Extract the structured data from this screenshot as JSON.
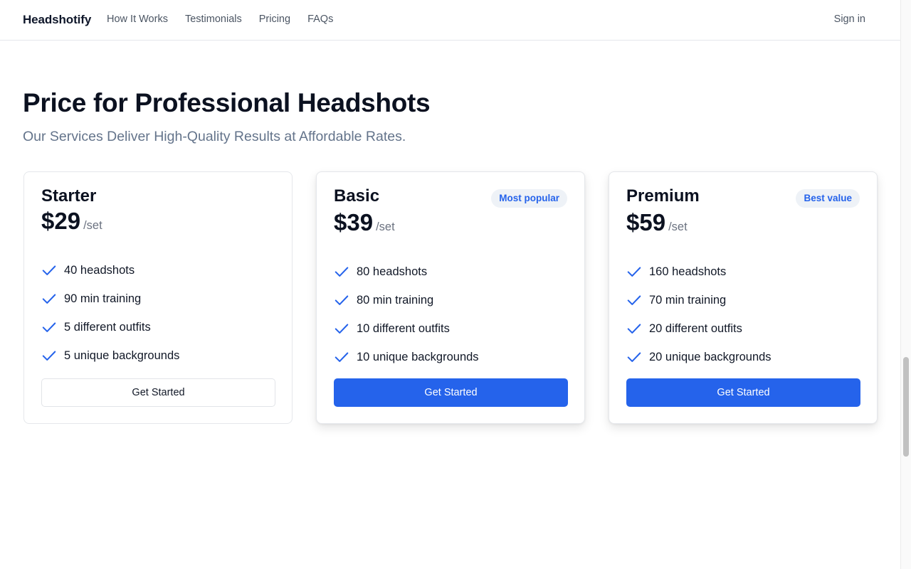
{
  "nav": {
    "brand": "Headshotify",
    "links": [
      "How It Works",
      "Testimonials",
      "Pricing",
      "FAQs"
    ],
    "signin": "Sign in"
  },
  "hero": {
    "title": "Price for Professional Headshots",
    "subtitle": "Our Services Deliver High-Quality Results at Affordable Rates."
  },
  "colors": {
    "accent": "#2563eb",
    "check": "#2563eb",
    "badge_bg": "#eef2f7"
  },
  "plans": [
    {
      "name": "Starter",
      "badge": "",
      "price": "$29",
      "unit": "/set",
      "features": [
        "40 headshots",
        "90 min training",
        "5 different outfits",
        "5 unique backgrounds"
      ],
      "cta": "Get Started",
      "cta_style": "outline"
    },
    {
      "name": "Basic",
      "badge": "Most popular",
      "price": "$39",
      "unit": "/set",
      "features": [
        "80 headshots",
        "80 min training",
        "10 different outfits",
        "10 unique backgrounds"
      ],
      "cta": "Get Started",
      "cta_style": "solid"
    },
    {
      "name": "Premium",
      "badge": "Best value",
      "price": "$59",
      "unit": "/set",
      "features": [
        "160 headshots",
        "70 min training",
        "20 different outfits",
        "20 unique backgrounds"
      ],
      "cta": "Get Started",
      "cta_style": "solid"
    }
  ]
}
